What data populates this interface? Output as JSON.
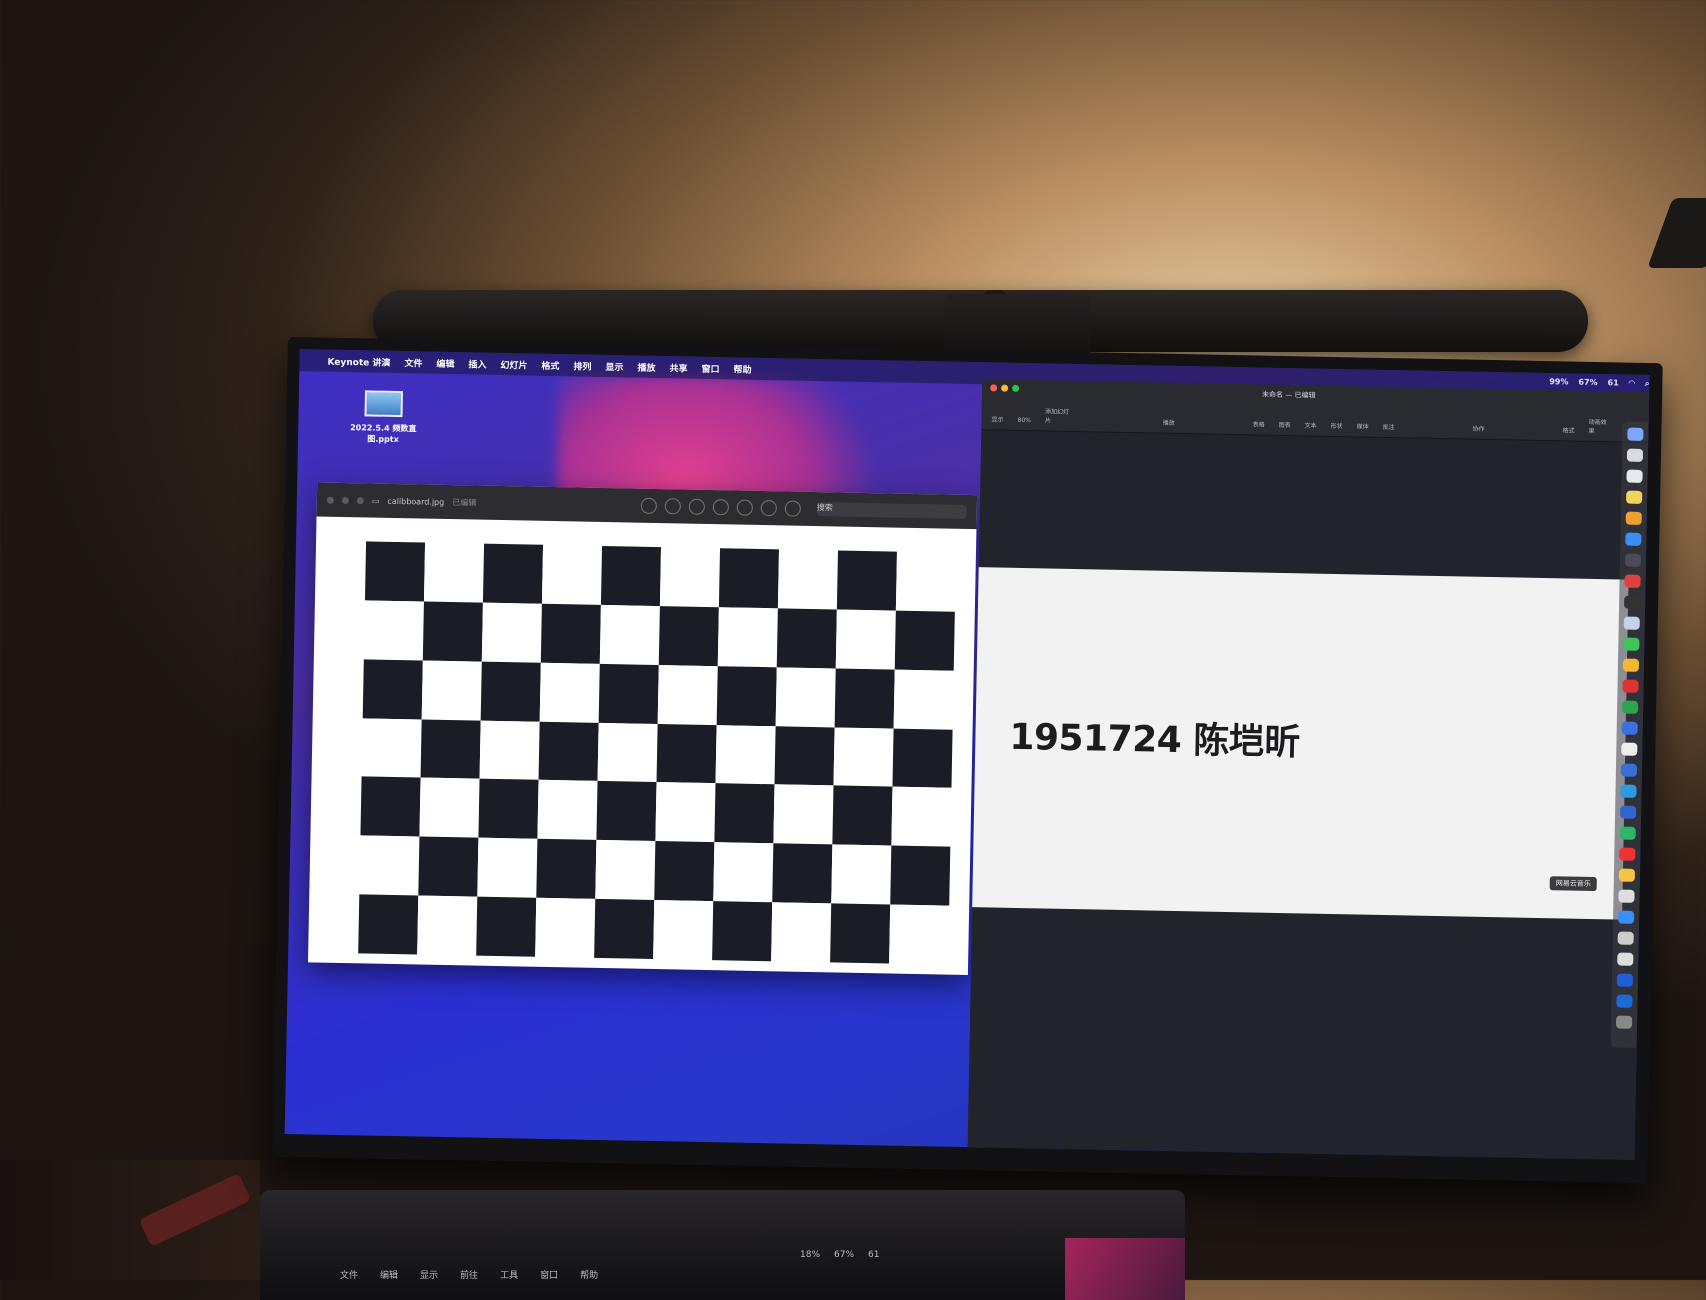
{
  "menubar": {
    "app": "Keynote 讲演",
    "items": [
      "文件",
      "编辑",
      "插入",
      "幻灯片",
      "格式",
      "排列",
      "显示",
      "播放",
      "共享",
      "窗口",
      "帮助"
    ],
    "status": [
      "99%",
      "67%",
      "61"
    ]
  },
  "desktop": {
    "icon_label": "2022.5.4 频数直图.pptx"
  },
  "preview": {
    "filename": "calibboard.jpg",
    "subtitle": "已编辑",
    "search_placeholder": "搜索"
  },
  "keynote": {
    "title": "未命名 — 已编辑",
    "zoom": "80%",
    "toolbar": [
      "显示",
      "缩放",
      "添加幻灯片",
      "播放",
      "表格",
      "图表",
      "文本",
      "形状",
      "媒体",
      "批注",
      "协作",
      "格式",
      "动画效果",
      "文稿"
    ],
    "slide_text": "1951724 陈垲昕",
    "tooltip": "网易云音乐"
  },
  "laptop": {
    "menu": [
      "文件",
      "编辑",
      "显示",
      "前往",
      "工具",
      "窗口",
      "帮助"
    ],
    "status": [
      "18%",
      "67%",
      "61"
    ]
  },
  "colors": {
    "wallpaper": "#2b2fd3",
    "slide_bg": "#f2f2f3",
    "board_dark": "#1a1c26"
  }
}
